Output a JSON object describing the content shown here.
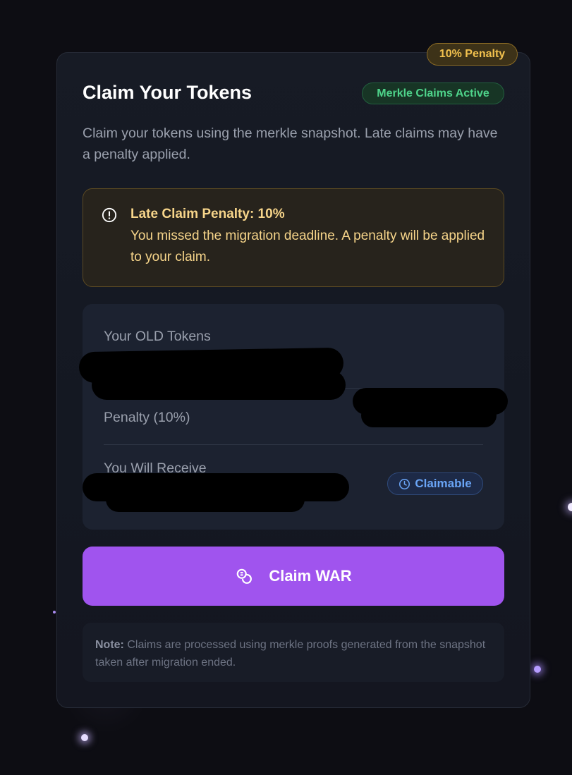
{
  "card": {
    "penalty_pill": "10% Penalty",
    "title": "Claim Your Tokens",
    "status_badge": "Merkle Claims Active",
    "subtitle": "Claim your tokens using the merkle snapshot. Late claims may have a penalty applied."
  },
  "alert": {
    "icon": "alert-circle-icon",
    "title": "Late Claim Penalty: 10%",
    "body": "You missed the migration deadline. A penalty will be applied to your claim."
  },
  "summary": {
    "old_tokens_label": "Your OLD Tokens",
    "penalty_label": "Penalty (10%)",
    "receive_label": "You Will Receive",
    "claimable_label": "Claimable",
    "claimable_icon": "clock-icon"
  },
  "claim_button": {
    "label": "Claim WAR",
    "icon": "coins-icon"
  },
  "note": {
    "prefix": "Note:",
    "text": " Claims are processed using merkle proofs generated from the snapshot taken after migration ended."
  },
  "colors": {
    "accent": "#a054ee",
    "warning": "#f2c14e",
    "success": "#4ed38a",
    "info": "#69a4f5"
  }
}
